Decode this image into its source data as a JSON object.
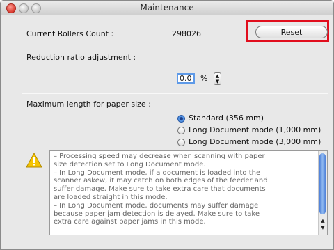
{
  "window": {
    "title": "Maintenance"
  },
  "rollers": {
    "label": "Current Rollers Count :",
    "value": "298026",
    "reset_label": "Reset"
  },
  "reduction": {
    "label": "Reduction ratio adjustment :",
    "value": "0.0",
    "unit": "%"
  },
  "paper": {
    "label": "Maximum length for paper size :",
    "options": [
      {
        "label": "Standard (356 mm)",
        "selected": true
      },
      {
        "label": "Long Document mode (1,000 mm)",
        "selected": false
      },
      {
        "label": "Long Document mode (3,000 mm)",
        "selected": false
      }
    ]
  },
  "message": {
    "lines": [
      "– Processing speed may decrease when scanning with paper",
      "size detection set to Long Document mode.",
      "– In Long Document mode, if a document is loaded into the",
      "scanner askew, it may catch on both edges of the feeder and",
      "suffer damage. Make sure to take extra care that documents",
      "are loaded straight in this mode.",
      "– In Long Document mode, documents may suffer damage",
      "because paper jam detection is delayed. Make sure to take",
      "extra care against paper jams in this mode."
    ]
  },
  "icons": {
    "warning": "warning-icon",
    "stepper": "stepper-icon"
  },
  "colors": {
    "highlight": "#e10e1d",
    "focus": "#5e9ae8",
    "warning": "#f5c400"
  }
}
